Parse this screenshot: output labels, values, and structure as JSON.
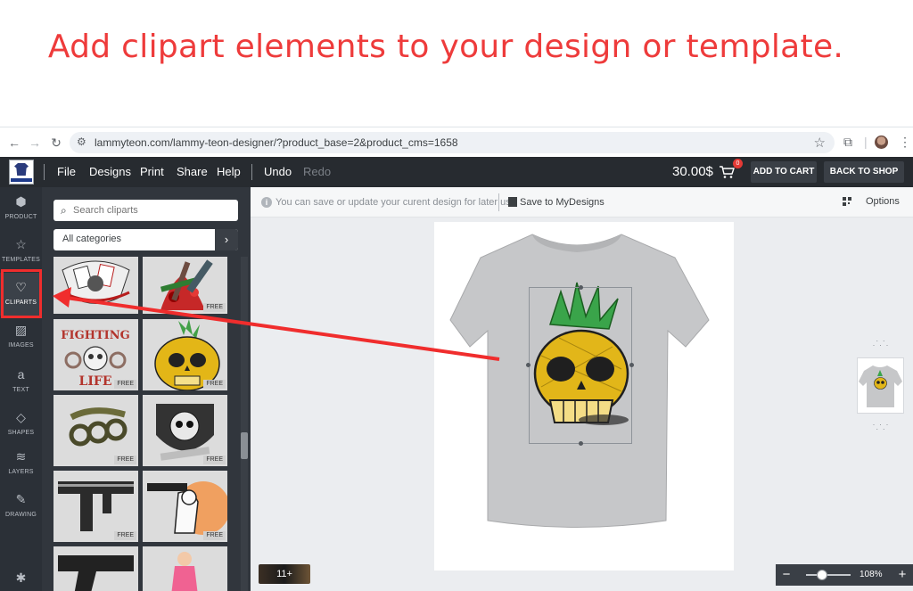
{
  "headline": "Add clipart elements to your design or template.",
  "browser": {
    "url": "lammyteon.com/lammy-teon-designer/?product_base=2&product_cms=1658"
  },
  "appbar": {
    "menu": [
      "File",
      "Designs",
      "Print",
      "Share",
      "Help"
    ],
    "undo": "Undo",
    "redo": "Redo",
    "price": "30.00$",
    "cart_count": "0",
    "add_to_cart": "ADD TO CART",
    "back_to_shop": "BACK TO SHOP"
  },
  "rail": [
    {
      "label": "PRODUCT",
      "icon": "cube-icon"
    },
    {
      "label": "TEMPLATES",
      "icon": "star-icon"
    },
    {
      "label": "CLIPARTS",
      "icon": "heart-icon"
    },
    {
      "label": "IMAGES",
      "icon": "image-icon"
    },
    {
      "label": "TEXT",
      "icon": "text-icon"
    },
    {
      "label": "SHAPES",
      "icon": "diamond-icon"
    },
    {
      "label": "LAYERS",
      "icon": "layers-icon"
    },
    {
      "label": "DRAWING",
      "icon": "pencil-icon"
    }
  ],
  "panel": {
    "search_placeholder": "Search cliparts",
    "category": "All categories",
    "free_label": "FREE"
  },
  "toolbar": {
    "info": "You can save or update your curent design for later use",
    "save": "Save to MyDesigns",
    "options": "Options"
  },
  "canvas": {
    "layers_count": "11+",
    "zoom": "108%",
    "zoom_fraction": 0.4
  },
  "colors": {
    "accent_red": "#ee3b3b",
    "appbar": "#272b30",
    "panel": "#31363d"
  }
}
